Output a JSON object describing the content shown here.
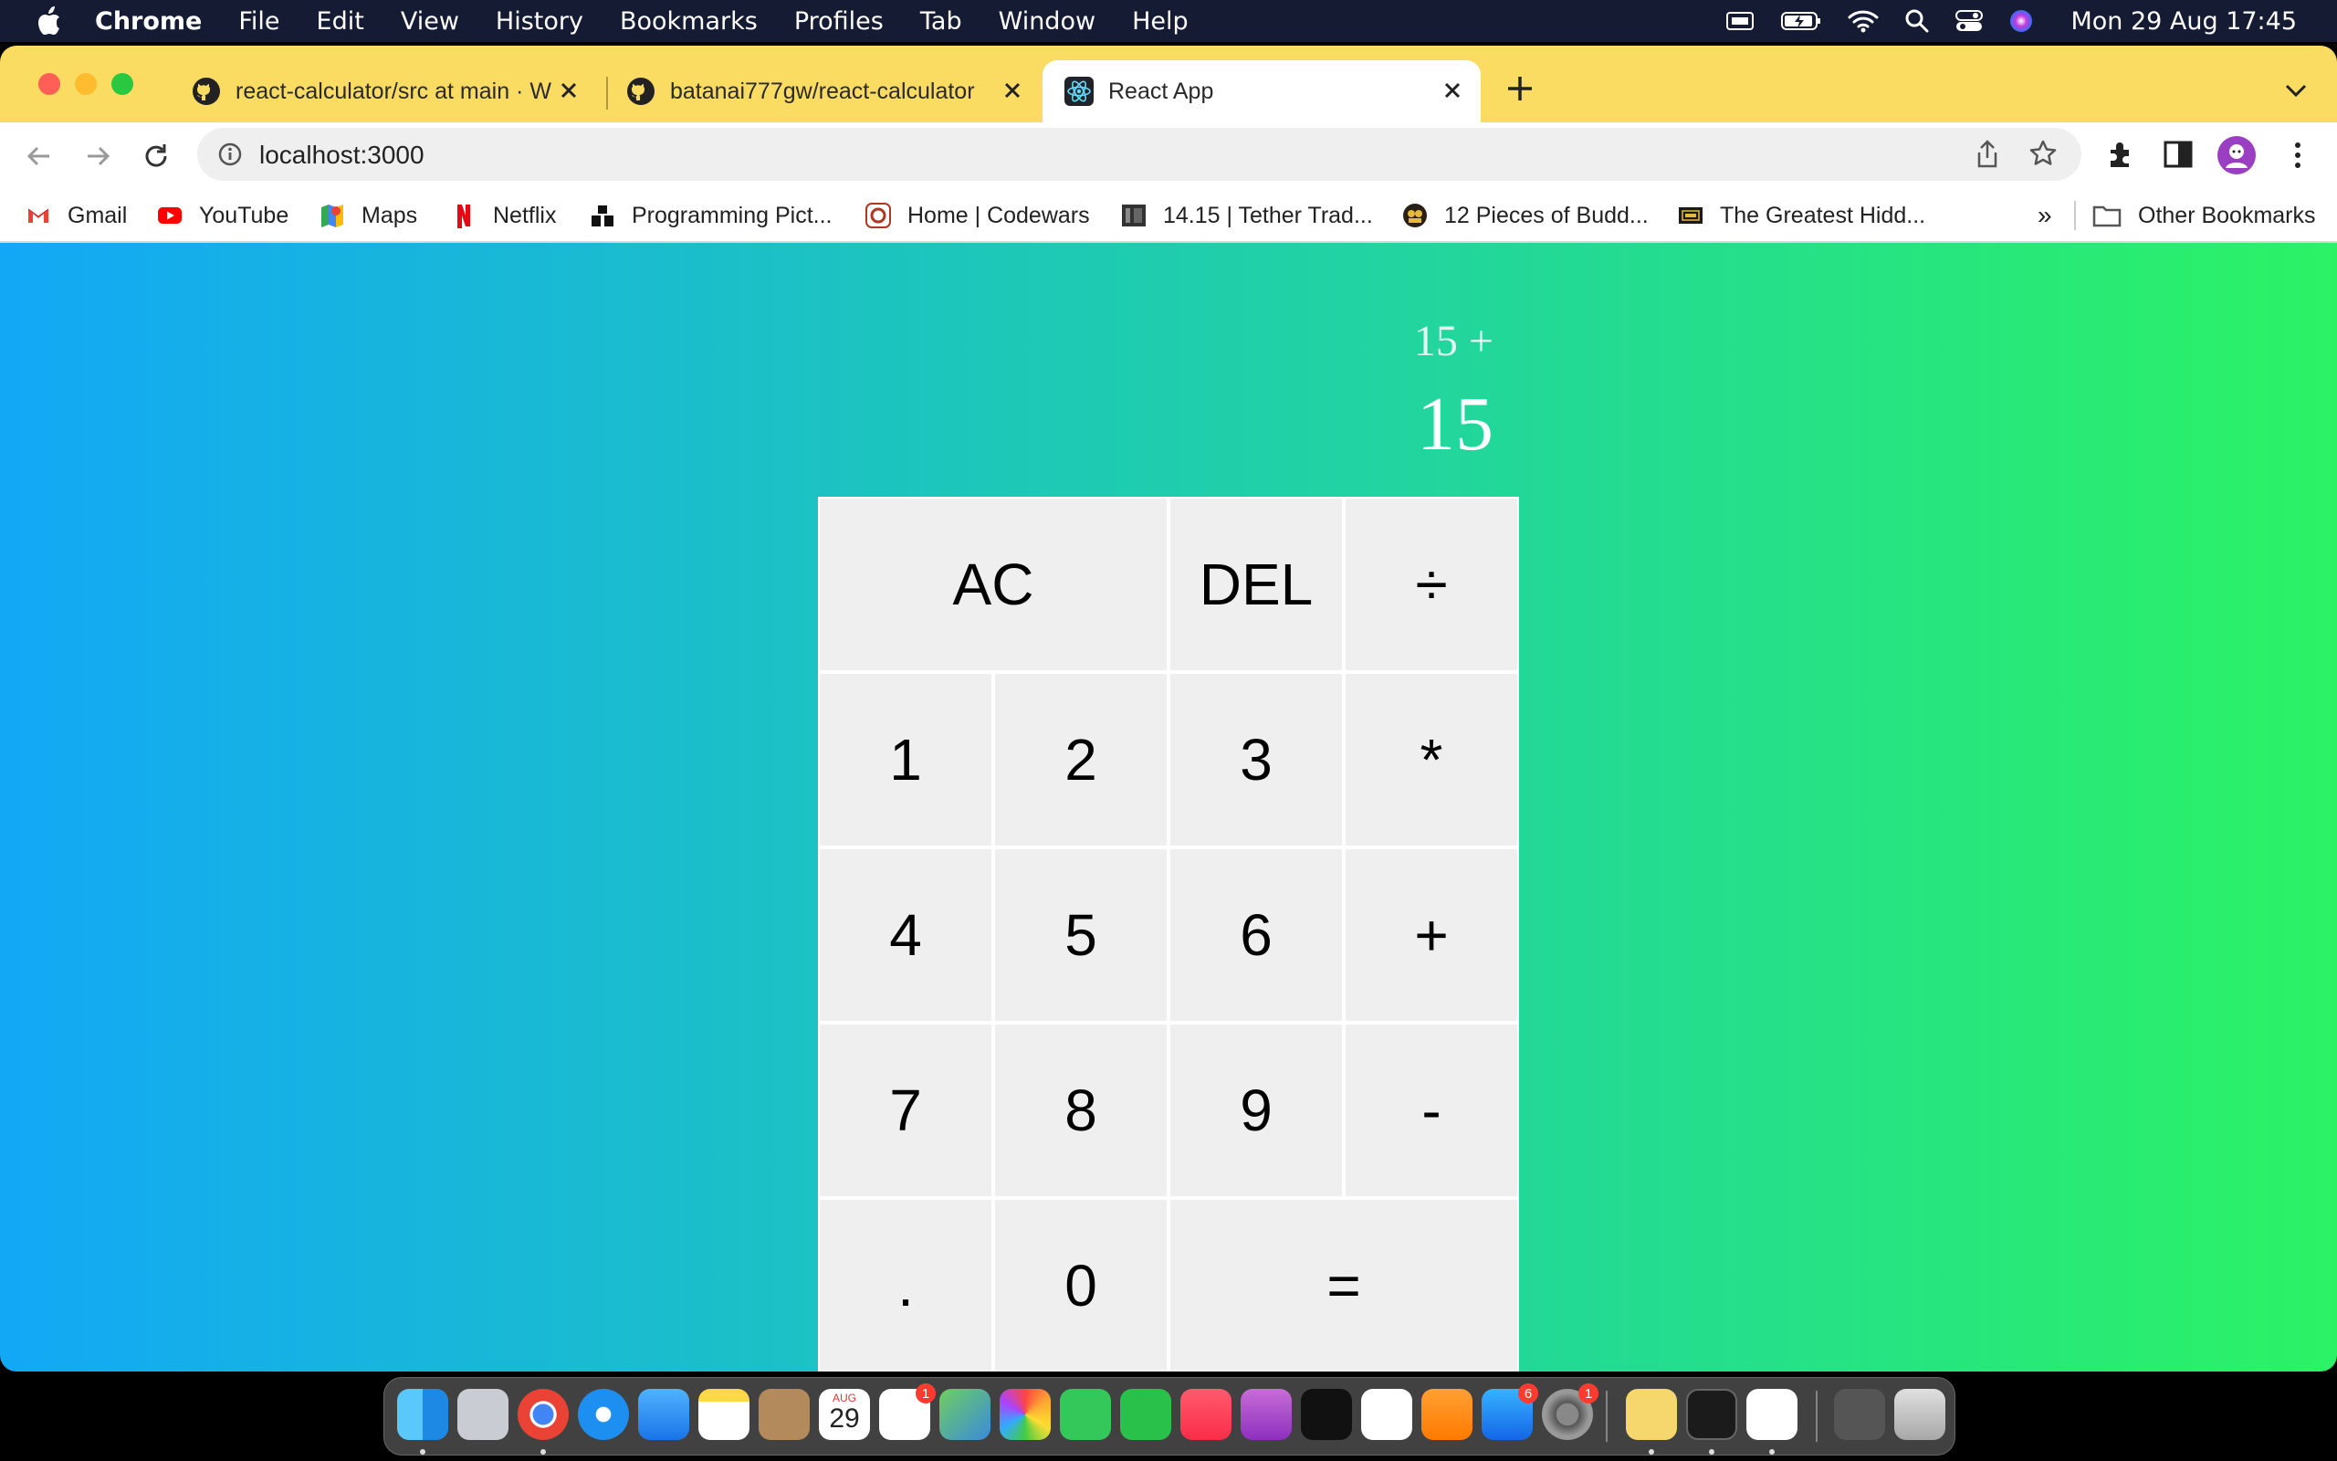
{
  "menubar": {
    "app": "Chrome",
    "items": [
      "File",
      "Edit",
      "View",
      "History",
      "Bookmarks",
      "Profiles",
      "Tab",
      "Window",
      "Help"
    ],
    "clock": "Mon 29 Aug  17:45"
  },
  "tabs": [
    {
      "title": "react-calculator/src at main · W",
      "icon": "github-icon"
    },
    {
      "title": "batanai777gw/react-calculator",
      "icon": "github-icon"
    },
    {
      "title": "React App",
      "icon": "react-icon",
      "active": true
    }
  ],
  "omnibox": {
    "url": "localhost:3000"
  },
  "bookmarks": {
    "items": [
      "Gmail",
      "YouTube",
      "Maps",
      "Netflix",
      "Programming Pict...",
      "Home | Codewars",
      "14.15 | Tether Trad...",
      "12 Pieces of Budd...",
      "The Greatest Hidd..."
    ],
    "overflow": "»",
    "other": "Other Bookmarks"
  },
  "calculator": {
    "previous_operand": "15 +",
    "current_operand": "15",
    "keys": [
      "AC",
      "DEL",
      "÷",
      "1",
      "2",
      "3",
      "*",
      "4",
      "5",
      "6",
      "+",
      "7",
      "8",
      "9",
      "-",
      ".",
      "0",
      "="
    ]
  },
  "dock": {
    "calendar_month": "AUG",
    "calendar_day": "29",
    "reminders_badge": "1",
    "appstore_badge": "6",
    "settings_badge": "1"
  },
  "colors": {
    "gradient_start": "#13a8f6",
    "gradient_end": "#2bf265",
    "tabstrip": "#fbdc62",
    "key_bg": "#efefef"
  }
}
